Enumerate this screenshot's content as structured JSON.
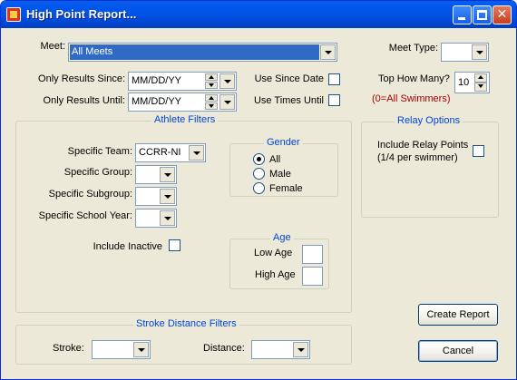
{
  "window": {
    "title": "High Point Report..."
  },
  "meet": {
    "label": "Meet:",
    "value": "All Meets"
  },
  "meet_type": {
    "label": "Meet Type:",
    "value": ""
  },
  "since": {
    "label": "Only Results Since:",
    "value": "MM/DD/YY",
    "use_label": "Use Since Date"
  },
  "until": {
    "label": "Only Results Until:",
    "value": "MM/DD/YY",
    "use_label": "Use Times Until"
  },
  "top_how_many": {
    "label": "Top How Many?",
    "value": "10",
    "note": "(0=All Swimmers)"
  },
  "athlete_filters": {
    "legend": "Athlete Filters",
    "team_label": "Specific Team:",
    "team_value": "CCRR-NI",
    "group_label": "Specific Group:",
    "group_value": "",
    "subgroup_label": "Specific Subgroup:",
    "subgroup_value": "",
    "school_year_label": "Specific  School Year:",
    "school_year_value": "",
    "inactive_label": "Include Inactive",
    "gender": {
      "legend": "Gender",
      "options": [
        "All",
        "Male",
        "Female"
      ],
      "selected": "All"
    },
    "age": {
      "legend": "Age",
      "low_label": "Low Age",
      "low_value": "",
      "high_label": "High Age",
      "high_value": ""
    }
  },
  "relay": {
    "legend": "Relay Options",
    "line1": "Include Relay Points",
    "line2": "(1/4 per swimmer)"
  },
  "stroke_filters": {
    "legend": "Stroke Distance Filters",
    "stroke_label": "Stroke:",
    "stroke_value": "",
    "distance_label": "Distance:",
    "distance_value": ""
  },
  "buttons": {
    "create": "Create Report",
    "cancel": "Cancel"
  },
  "colors": {
    "title_bar": "#0058ee",
    "group_legend": "#0046d5",
    "selection": "#316ac5",
    "note": "#a00000"
  }
}
